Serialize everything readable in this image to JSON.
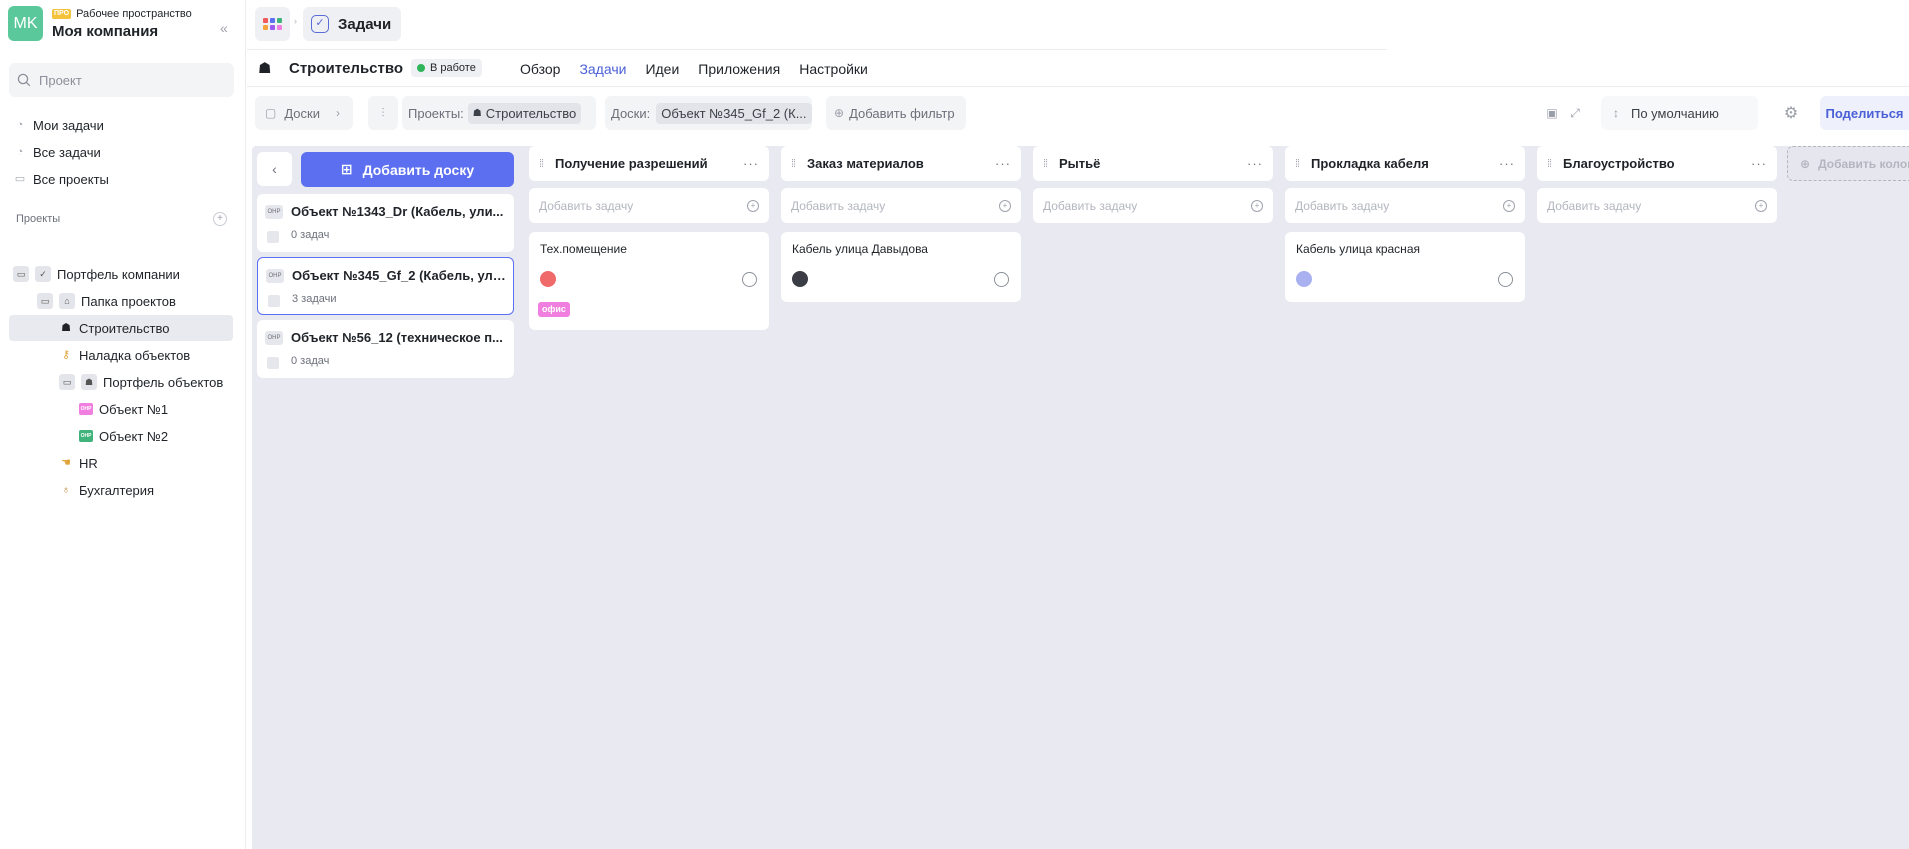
{
  "workspace": {
    "avatar_initials": "MK",
    "badge": "ПРО",
    "subtitle": "Рабочее пространство",
    "name": "Моя компания"
  },
  "sidebar": {
    "search_placeholder": "Проект",
    "nav": [
      {
        "label": "Мои задачи",
        "icon": "check-circle-icon"
      },
      {
        "label": "Все задачи",
        "icon": "check-circle-icon"
      },
      {
        "label": "Все проекты",
        "icon": "folder-icon"
      }
    ],
    "projects_label": "Проекты",
    "tree": [
      {
        "label": "Портфель компании"
      },
      {
        "label": "Папка проектов"
      },
      {
        "label": "Строительство"
      },
      {
        "label": "Наладка объектов"
      },
      {
        "label": "Портфель объектов"
      },
      {
        "label": "Объект №1",
        "badge": "ОНР"
      },
      {
        "label": "Объект №2",
        "badge": "ОНР"
      },
      {
        "label": "HR"
      },
      {
        "label": "Бухгалтерия"
      }
    ]
  },
  "topbar": {
    "tab_label": "Задачи"
  },
  "project": {
    "title": "Строительство",
    "status": "В работе",
    "tabs": [
      {
        "label": "Обзор"
      },
      {
        "label": "Задачи"
      },
      {
        "label": "Идеи"
      },
      {
        "label": "Приложения"
      },
      {
        "label": "Настройки"
      }
    ]
  },
  "toolbar": {
    "boards_label": "Доски",
    "projects_filter_label": "Проекты:",
    "projects_filter_value": "Строительство",
    "boards_filter_label": "Доски:",
    "boards_filter_value": "Объект №345_Gf_2 (К...",
    "add_filter": "Добавить фильтр",
    "sort_label": "По умолчанию",
    "share": "Поделиться"
  },
  "boards_panel": {
    "add_board": "Добавить доску",
    "boards": [
      {
        "code": "ОНР",
        "title": "Объект №1343_Dr (Кабель, ули...",
        "count": "0 задач"
      },
      {
        "code": "ОНР",
        "title": "Объект №345_Gf_2 (Кабель, ули...",
        "count": "3 задачи"
      },
      {
        "code": "ОНР",
        "title": "Объект №56_12 (техническое п...",
        "count": "0 задач"
      }
    ]
  },
  "kanban": {
    "add_task_placeholder": "Добавить задачу",
    "add_column": "Добавить колонку",
    "columns": [
      {
        "title": "Получение разрешений",
        "task": {
          "title": "Тех.помещение",
          "avatar_color": "#f06a6a",
          "tag": "офис"
        }
      },
      {
        "title": "Заказ материалов",
        "task": {
          "title": "Кабель улица Давыдова",
          "avatar_color": "#3a3d44"
        }
      },
      {
        "title": "Рытьё"
      },
      {
        "title": "Прокладка кабеля",
        "task": {
          "title": "Кабель улица красная",
          "avatar_color": "#a9b1f0"
        }
      },
      {
        "title": "Благоустройство"
      }
    ]
  },
  "colors": {
    "accent": "#5b6ff0",
    "accent_text": "#4b5fd6",
    "status_green": "#2fb45a",
    "tag_pink": "#f07fdf",
    "workspace_green": "#5bc89c"
  }
}
